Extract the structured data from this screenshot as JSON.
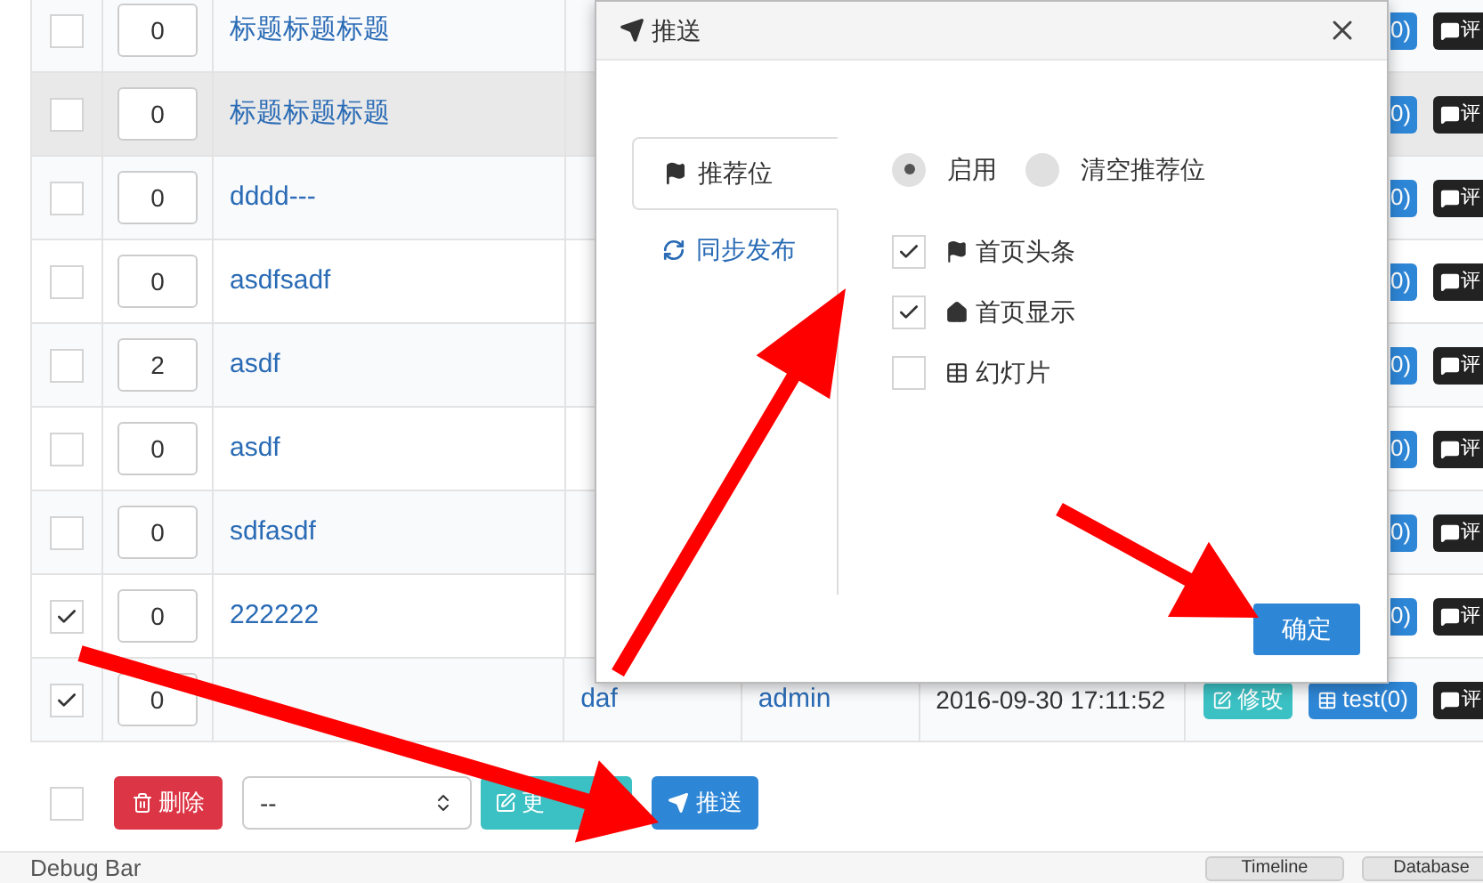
{
  "table": {
    "rows": [
      {
        "checked": false,
        "highlighted": false,
        "sort": "0",
        "title": "标题标题标题",
        "tag_button": "0)",
        "comment_button": "评"
      },
      {
        "checked": false,
        "highlighted": true,
        "sort": "0",
        "title": "标题标题标题",
        "tag_button": "0)",
        "comment_button": "评"
      },
      {
        "checked": false,
        "highlighted": false,
        "sort": "0",
        "title": "dddd---",
        "tag_button": "0)",
        "comment_button": "评"
      },
      {
        "checked": false,
        "highlighted": false,
        "sort": "0",
        "title": "asdfsadf",
        "tag_button": "0)",
        "comment_button": "评"
      },
      {
        "checked": false,
        "highlighted": false,
        "sort": "2",
        "title": "asdf",
        "tag_button": "0)",
        "comment_button": "评"
      },
      {
        "checked": false,
        "highlighted": false,
        "sort": "0",
        "title": "asdf",
        "tag_button": "0)",
        "comment_button": "评"
      },
      {
        "checked": false,
        "highlighted": false,
        "sort": "0",
        "title": "sdfasdf",
        "tag_button": "0)",
        "comment_button": "评"
      },
      {
        "checked": true,
        "highlighted": false,
        "sort": "0",
        "title": "222222",
        "tag_button": "0)",
        "comment_button": "评"
      },
      {
        "checked": true,
        "highlighted": false,
        "sort": "0",
        "col4": "daf",
        "author": "admin",
        "date": "2016-09-30 17:11:52",
        "edit_button": "修改",
        "tag_button": "test(0)",
        "comment_button": "评"
      }
    ]
  },
  "footer": {
    "select_all_checked": false,
    "delete_button": "删除",
    "select_value": "--",
    "move_button": "更",
    "push_button": "推送"
  },
  "debug_bar": {
    "title": "Debug Bar",
    "buttons": [
      "Timeline",
      "Database"
    ]
  },
  "modal": {
    "title": "推送",
    "tabs": [
      {
        "label": "推荐位",
        "selected": true
      },
      {
        "label": "同步发布",
        "selected": false
      }
    ],
    "radios": [
      {
        "label": "启用",
        "selected": true
      },
      {
        "label": "清空推荐位",
        "selected": false
      }
    ],
    "options": [
      {
        "label": "首页头条",
        "checked": true
      },
      {
        "label": "首页显示",
        "checked": true
      },
      {
        "label": "幻灯片",
        "checked": false
      }
    ],
    "confirm": "确定"
  }
}
